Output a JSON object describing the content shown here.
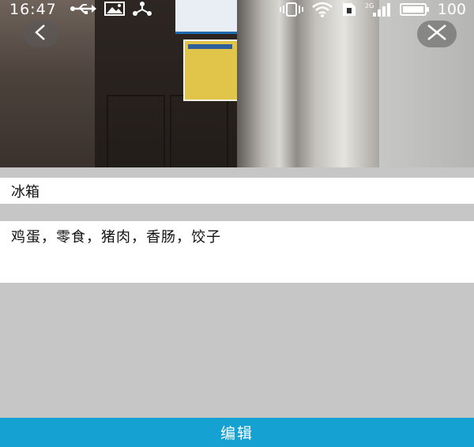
{
  "status_bar": {
    "time": "16:47",
    "battery_percent": "100",
    "network_label": "2G",
    "left_icons": [
      "usb-icon",
      "image-icon",
      "share-icon"
    ],
    "right_icons": [
      "vibrate-icon",
      "wifi-icon",
      "sim-icon",
      "signal-icon",
      "battery-icon"
    ]
  },
  "header": {
    "back_icon": "chevron-left-icon",
    "close_icon": "close-icon"
  },
  "item": {
    "title": "冰箱",
    "content": "鸡蛋，零食，猪肉，香肠，饺子"
  },
  "footer": {
    "edit_label": "编辑"
  },
  "colors": {
    "accent": "#16a1d3",
    "background": "#c6c6c6",
    "card": "#ffffff"
  }
}
